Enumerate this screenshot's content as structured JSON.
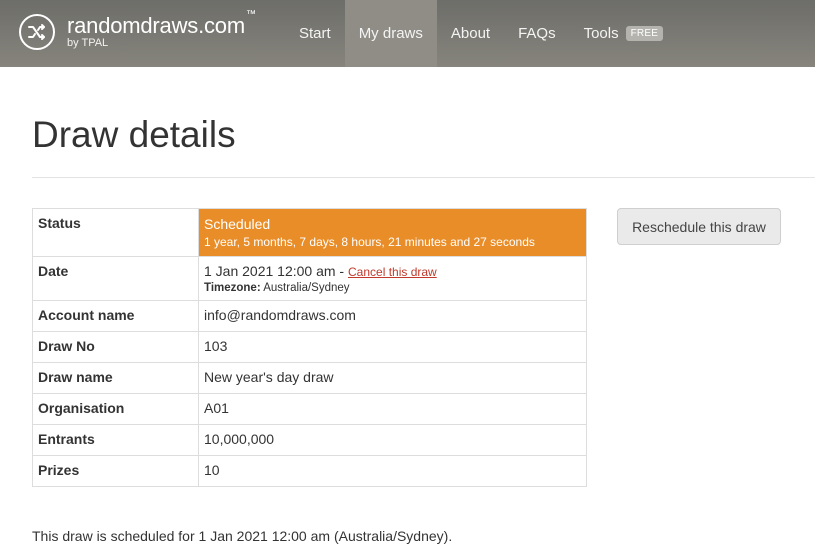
{
  "brand": {
    "name": "randomdraws.com",
    "trademark": "™",
    "subtitle": "by TPAL"
  },
  "nav": {
    "items": [
      {
        "label": "Start"
      },
      {
        "label": "My draws"
      },
      {
        "label": "About"
      },
      {
        "label": "FAQs"
      },
      {
        "label": "Tools"
      }
    ],
    "active_item": "My draws",
    "tools_badge": "FREE"
  },
  "page_title": "Draw details",
  "details": {
    "status": {
      "label": "Status",
      "value": "Scheduled",
      "countdown": "1 year, 5 months, 7 days, 8 hours, 21 minutes and 27 seconds",
      "color": "#e98d28"
    },
    "date": {
      "label": "Date",
      "value": "1 Jan 2021 12:00 am",
      "separator": " - ",
      "cancel_link": "Cancel this draw",
      "timezone_label": "Timezone:",
      "timezone_value": "Australia/Sydney"
    },
    "account_name": {
      "label": "Account name",
      "value": "info@randomdraws.com"
    },
    "draw_no": {
      "label": "Draw No",
      "value": "103"
    },
    "draw_name": {
      "label": "Draw name",
      "value": "New year's day draw"
    },
    "organisation": {
      "label": "Organisation",
      "value": "A01"
    },
    "entrants": {
      "label": "Entrants",
      "value": "10,000,000"
    },
    "prizes": {
      "label": "Prizes",
      "value": "10"
    }
  },
  "reschedule_button": "Reschedule this draw",
  "footnote": "This draw is scheduled for 1 Jan 2021 12:00 am (Australia/Sydney).",
  "icons": {
    "logo": "shuffle-icon"
  }
}
